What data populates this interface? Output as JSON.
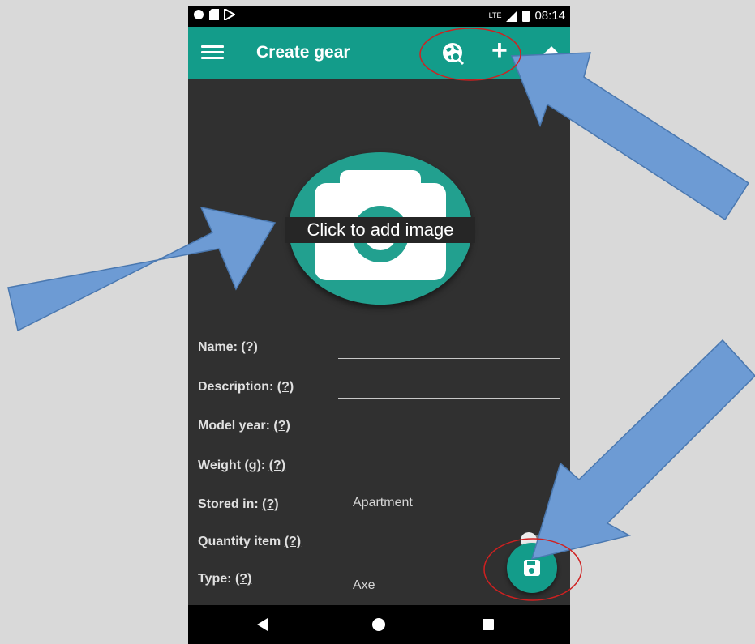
{
  "status_bar": {
    "network": "LTE",
    "time": "08:14"
  },
  "app_bar": {
    "title": "Create gear",
    "menu_icon": "menu-icon",
    "actions": [
      "globe-search-icon",
      "add-icon",
      "collapse-up-icon"
    ]
  },
  "image_picker": {
    "caption": "Click to add image",
    "icon": "camera-icon"
  },
  "form": {
    "name_label": "Name:",
    "description_label": "Description:",
    "model_year_label": "Model year:",
    "weight_label": "Weight (g):",
    "stored_in_label": "Stored in:",
    "quantity_label": "Quantity item",
    "type_label": "Type:",
    "help_marker": "(?)",
    "stored_in_value": "Apartment",
    "type_value": "Axe",
    "name_value": "",
    "description_value": "",
    "model_year_value": "",
    "weight_value": ""
  },
  "fab": {
    "icon": "save-icon"
  },
  "nav_bar": {
    "icons": [
      "back-icon",
      "home-icon",
      "recents-icon"
    ]
  },
  "colors": {
    "accent": "#139c8a",
    "background": "#303030",
    "annotation_arrow": "#6d9bd4",
    "annotation_circle": "#d02020"
  }
}
